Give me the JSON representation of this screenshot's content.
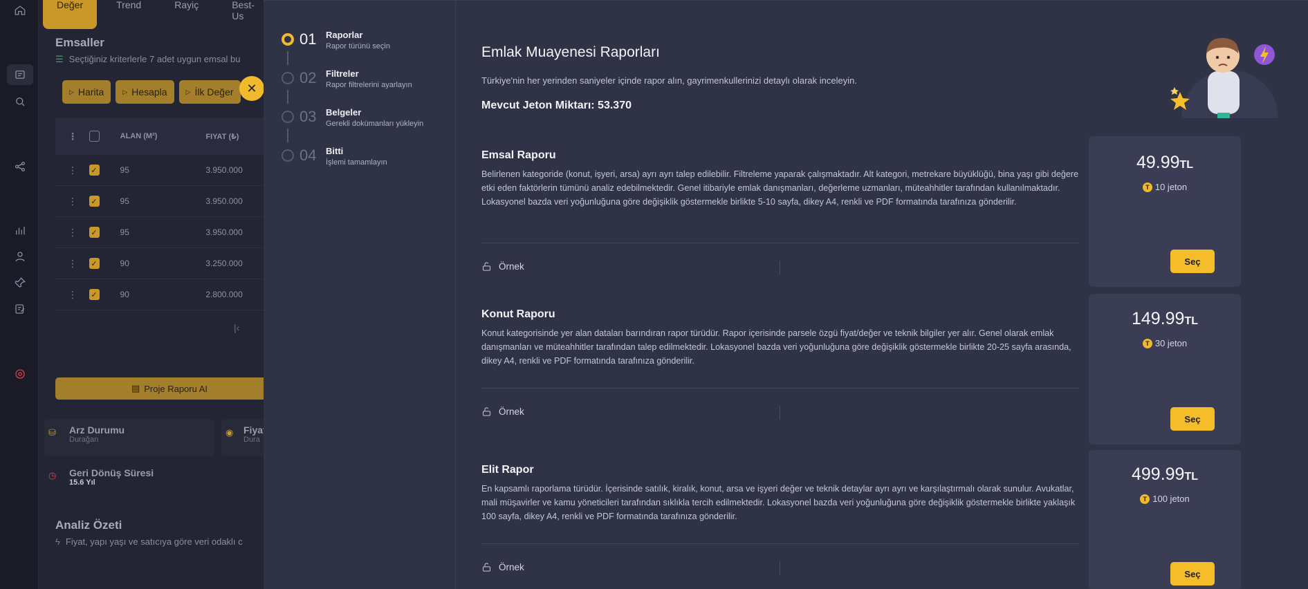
{
  "background": {
    "tabs": [
      "Değer",
      "Trend",
      "Rayiç",
      "Best-Us"
    ],
    "emsaller_title": "Emsaller",
    "emsaller_sub": "Seçtiğiniz kriterlerle 7 adet uygun emsal bu",
    "buttons": [
      "Harita",
      "Hesapla",
      "İlk Değer"
    ],
    "table": {
      "headers": [
        "ALAN (M²)",
        "FIYAT (₺)"
      ],
      "rows": [
        {
          "alan": "95",
          "fiyat": "3.950.000"
        },
        {
          "alan": "95",
          "fiyat": "3.950.000"
        },
        {
          "alan": "95",
          "fiyat": "3.950.000"
        },
        {
          "alan": "90",
          "fiyat": "3.250.000"
        },
        {
          "alan": "90",
          "fiyat": "2.800.000"
        }
      ]
    },
    "proje_button": "Proje Raporu AI",
    "cards": {
      "arz_title": "Arz Durumu",
      "arz_value": "Durağan",
      "fiyat_title": "Fiyat",
      "fiyat_value": "Dura",
      "geri_title": "Geri Dönüş Süresi",
      "geri_value": "15.6 Yıl"
    },
    "analiz_title": "Analiz Özeti",
    "analiz_sub": "Fiyat, yapı yaşı ve satıcıya göre veri odaklı c"
  },
  "steps": [
    {
      "num": "01",
      "title": "Raporlar",
      "desc": "Rapor türünü seçin"
    },
    {
      "num": "02",
      "title": "Filtreler",
      "desc": "Rapor filtrelerini ayarlayın"
    },
    {
      "num": "03",
      "title": "Belgeler",
      "desc": "Gerekli dokümanları yükleyin"
    },
    {
      "num": "04",
      "title": "Bitti",
      "desc": "İşlemi tamamlayın"
    }
  ],
  "modal": {
    "title": "Emlak Muayenesi Raporları",
    "description": "Türkiye'nin her yerinden saniyeler içinde rapor alın, gayrimenkullerinizi detaylı olarak inceleyin.",
    "jeton_label": "Mevcut Jeton Miktarı:",
    "jeton_value": "53.370",
    "ornek_label": "Örnek",
    "select_label": "Seç",
    "currency": "TL",
    "reports": [
      {
        "title": "Emsal Raporu",
        "desc": "Belirlenen kategoride (konut, işyeri, arsa) ayrı ayrı talep edilebilir. Filtreleme yaparak çalışmaktadır. Alt kategori, metrekare büyüklüğü, bina yaşı gibi değere etki eden faktörlerin tümünü analiz edebilmektedir. Genel itibariyle emlak danışmanları, değerleme uzmanları, müteahhitler tarafından kullanılmaktadır. Lokasyonel bazda veri yoğunluğuna göre değişiklik göstermekle birlikte 5-10 sayfa, dikey A4, renkli ve PDF formatında tarafınıza gönderilir.",
        "price": "49.99",
        "jeton": "10 jeton"
      },
      {
        "title": "Konut Raporu",
        "desc": "Konut kategorisinde yer alan dataları barındıran rapor türüdür. Rapor içerisinde parsele özgü fiyat/değer ve teknik bilgiler yer alır. Genel olarak emlak danışmanları ve müteahhitler tarafından talep edilmektedir. Lokasyonel bazda veri yoğunluğuna göre değişiklik göstermekle birlikte 20-25 sayfa arasında, dikey A4, renkli ve PDF formatında tarafınıza gönderilir.",
        "price": "149.99",
        "jeton": "30 jeton"
      },
      {
        "title": "Elit Rapor",
        "desc": "En kapsamlı raporlama türüdür. İçerisinde satılık, kiralık, konut, arsa ve işyeri değer ve teknik detaylar ayrı ayrı ve karşılaştırmalı olarak sunulur. Avukatlar, mali müşavirler ve kamu yöneticileri tarafından sıklıkla tercih edilmektedir. Lokasyonel bazda veri yoğunluğuna göre değişiklik göstermekle birlikte yaklaşık 100 sayfa, dikey A4, renkli ve PDF formatında tarafınıza gönderilir.",
        "price": "499.99",
        "jeton": "100 jeton"
      }
    ]
  },
  "colors": {
    "accent": "#f6bd2b",
    "modal_bg": "#303246",
    "card_bg": "#3a3d53"
  }
}
